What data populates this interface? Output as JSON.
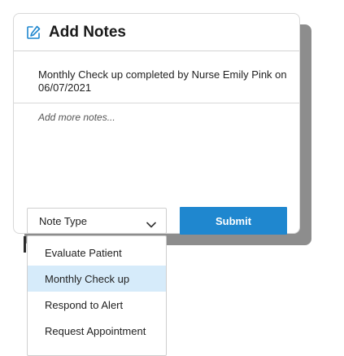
{
  "dialog": {
    "title": "Add Notes",
    "icon": "edit-icon",
    "note_text": "Monthly Check up completed by Nurse Emily Pink on 06/07/2021",
    "add_more_placeholder": "Add more notes..."
  },
  "footer": {
    "note_type_label": "Note Type",
    "submit_label": "Submit"
  },
  "dropdown": {
    "options": [
      {
        "label": "Evaluate Patient",
        "selected": false
      },
      {
        "label": "Monthly Check up",
        "selected": true
      },
      {
        "label": "Respond to Alert",
        "selected": false
      },
      {
        "label": "Request Appointment",
        "selected": false
      }
    ]
  },
  "colors": {
    "accent": "#1f87cf",
    "selected_option": "#d6ebfa",
    "shadow": "#8d8d8d"
  }
}
